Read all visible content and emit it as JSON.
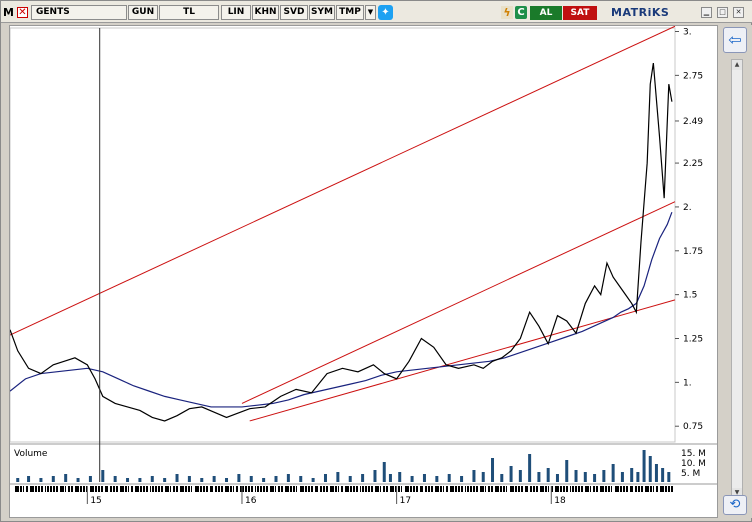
{
  "toolbar": {
    "logo_letter": "M",
    "symbol": "GENTS",
    "period_label": "GUN",
    "currency_label": "TL",
    "scale_label": "LIN",
    "khn_label": "KHN",
    "svd_label": "SVD",
    "sym_label": "SYM",
    "tmp_label": "TMP",
    "buy_label": "AL",
    "sell_label": "SAT",
    "brand": "MATRiKS"
  },
  "colors": {
    "price": "#000000",
    "moving_average": "#1a237e",
    "trend_line": "#cc1111",
    "volume": "#1f4e79",
    "grid": "#c8c8c8"
  },
  "chart_data": {
    "type": "line",
    "price_axis": {
      "ticks": [
        "3.",
        "2.75",
        "2.49",
        "2.25",
        "2.",
        "1.75",
        "1.5",
        "1.25",
        "1.",
        "0.75"
      ],
      "values": [
        3.0,
        2.75,
        2.49,
        2.25,
        2.0,
        1.75,
        1.5,
        1.25,
        1.0,
        0.75
      ],
      "range": [
        0.66,
        3.02
      ]
    },
    "x_axis": {
      "ticks": [
        "15",
        "16",
        "17",
        "18"
      ],
      "tick_positions": [
        2015,
        2016,
        2017,
        2018
      ],
      "range": [
        2014.5,
        2018.8
      ]
    },
    "price_series": {
      "x": [
        2014.5,
        2014.55,
        2014.62,
        2014.7,
        2014.78,
        2014.85,
        2014.92,
        2015.0,
        2015.05,
        2015.1,
        2015.18,
        2015.26,
        2015.34,
        2015.42,
        2015.5,
        2015.58,
        2015.66,
        2015.74,
        2015.82,
        2015.9,
        2015.96,
        2016.05,
        2016.15,
        2016.25,
        2016.35,
        2016.45,
        2016.55,
        2016.65,
        2016.75,
        2016.85,
        2016.92,
        2017.0,
        2017.08,
        2017.16,
        2017.24,
        2017.32,
        2017.4,
        2017.5,
        2017.56,
        2017.62,
        2017.68,
        2017.74,
        2017.8,
        2017.86,
        2017.92,
        2017.98,
        2018.04,
        2018.1,
        2018.16,
        2018.22,
        2018.28,
        2018.32,
        2018.36,
        2018.4,
        2018.44,
        2018.48,
        2018.52,
        2018.55,
        2018.58,
        2018.62,
        2018.64,
        2018.66,
        2018.7,
        2018.73,
        2018.76,
        2018.78
      ],
      "values": [
        1.3,
        1.18,
        1.08,
        1.05,
        1.1,
        1.12,
        1.14,
        1.1,
        1.02,
        0.92,
        0.88,
        0.86,
        0.84,
        0.8,
        0.78,
        0.81,
        0.85,
        0.86,
        0.83,
        0.8,
        0.82,
        0.85,
        0.86,
        0.92,
        0.96,
        0.94,
        1.05,
        1.08,
        1.06,
        1.1,
        1.05,
        1.02,
        1.12,
        1.25,
        1.2,
        1.1,
        1.08,
        1.1,
        1.08,
        1.12,
        1.14,
        1.18,
        1.25,
        1.4,
        1.32,
        1.22,
        1.38,
        1.35,
        1.28,
        1.45,
        1.55,
        1.5,
        1.68,
        1.6,
        1.55,
        1.5,
        1.45,
        1.4,
        1.8,
        2.25,
        2.7,
        2.82,
        2.4,
        2.05,
        2.7,
        2.6
      ],
      "color": "#000000"
    },
    "ma_series": {
      "x": [
        2014.5,
        2014.6,
        2014.7,
        2014.8,
        2014.9,
        2015.0,
        2015.1,
        2015.2,
        2015.3,
        2015.4,
        2015.5,
        2015.6,
        2015.7,
        2015.8,
        2015.9,
        2016.0,
        2016.1,
        2016.2,
        2016.3,
        2016.4,
        2016.5,
        2016.6,
        2016.7,
        2016.8,
        2016.9,
        2017.0,
        2017.1,
        2017.2,
        2017.3,
        2017.4,
        2017.5,
        2017.6,
        2017.7,
        2017.8,
        2017.9,
        2018.0,
        2018.1,
        2018.2,
        2018.3,
        2018.4,
        2018.45,
        2018.5,
        2018.55,
        2018.6,
        2018.65,
        2018.7,
        2018.75,
        2018.78
      ],
      "values": [
        0.95,
        1.02,
        1.05,
        1.06,
        1.07,
        1.08,
        1.06,
        1.02,
        0.98,
        0.95,
        0.92,
        0.9,
        0.88,
        0.86,
        0.86,
        0.86,
        0.87,
        0.88,
        0.9,
        0.93,
        0.95,
        0.97,
        0.99,
        1.01,
        1.04,
        1.06,
        1.07,
        1.08,
        1.09,
        1.1,
        1.11,
        1.12,
        1.14,
        1.17,
        1.2,
        1.23,
        1.26,
        1.29,
        1.33,
        1.37,
        1.4,
        1.42,
        1.45,
        1.55,
        1.7,
        1.82,
        1.9,
        1.97
      ],
      "color": "#1a237e"
    },
    "trend_lines": [
      {
        "x": [
          2014.5,
          2018.8
        ],
        "values": [
          1.27,
          3.03
        ]
      },
      {
        "x": [
          2016.0,
          2018.8
        ],
        "values": [
          0.88,
          2.03
        ]
      },
      {
        "x": [
          2016.05,
          2018.8
        ],
        "values": [
          0.78,
          1.47
        ]
      }
    ],
    "cursor_x": 2015.08,
    "volume": {
      "label": "Volume",
      "ticks": [
        "15. M",
        "10. M",
        "5. M"
      ],
      "tick_values": [
        15,
        10,
        5
      ],
      "max": 18,
      "x": [
        2014.55,
        2014.62,
        2014.7,
        2014.78,
        2014.86,
        2014.94,
        2015.02,
        2015.1,
        2015.18,
        2015.26,
        2015.34,
        2015.42,
        2015.5,
        2015.58,
        2015.66,
        2015.74,
        2015.82,
        2015.9,
        2015.98,
        2016.06,
        2016.14,
        2016.22,
        2016.3,
        2016.38,
        2016.46,
        2016.54,
        2016.62,
        2016.7,
        2016.78,
        2016.86,
        2016.92,
        2016.96,
        2017.02,
        2017.1,
        2017.18,
        2017.26,
        2017.34,
        2017.42,
        2017.5,
        2017.56,
        2017.62,
        2017.68,
        2017.74,
        2017.8,
        2017.86,
        2017.92,
        2017.98,
        2018.04,
        2018.1,
        2018.16,
        2018.22,
        2018.28,
        2018.34,
        2018.4,
        2018.46,
        2018.52,
        2018.56,
        2018.6,
        2018.64,
        2018.68,
        2018.72,
        2018.76
      ],
      "values": [
        2,
        3,
        2,
        3,
        4,
        2,
        3,
        6,
        3,
        2,
        2,
        3,
        2,
        4,
        3,
        2,
        3,
        2,
        4,
        3,
        2,
        3,
        4,
        3,
        2,
        4,
        5,
        3,
        4,
        6,
        10,
        4,
        5,
        3,
        4,
        3,
        4,
        3,
        6,
        5,
        12,
        4,
        8,
        6,
        14,
        5,
        7,
        4,
        11,
        6,
        5,
        4,
        6,
        9,
        5,
        7,
        5,
        16,
        13,
        9,
        7,
        5
      ]
    }
  }
}
